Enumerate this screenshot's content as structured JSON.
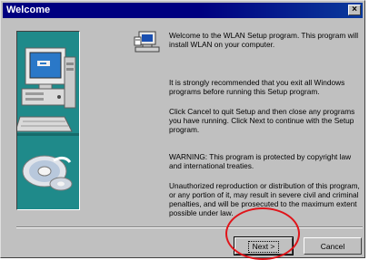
{
  "window": {
    "title": "Welcome",
    "close_glyph": "×"
  },
  "content": {
    "paragraphs": [
      "Welcome to the WLAN Setup program.  This program will install WLAN on your computer.",
      "It is strongly recommended that you exit all Windows programs before running this Setup program.",
      "Click Cancel to quit Setup and then close any programs you have running.  Click Next to continue with the Setup program.",
      "WARNING: This program is protected by copyright law and international treaties.",
      "Unauthorized reproduction or distribution of this program, or any portion of it, may result in severe civil and criminal penalties, and will be prosecuted to the maximum extent possible under law."
    ]
  },
  "buttons": {
    "next": "Next >",
    "cancel": "Cancel"
  },
  "icons": [
    "setup-icon",
    "computer-illustration",
    "disc-icon"
  ],
  "annotation_color": "#e0141a"
}
